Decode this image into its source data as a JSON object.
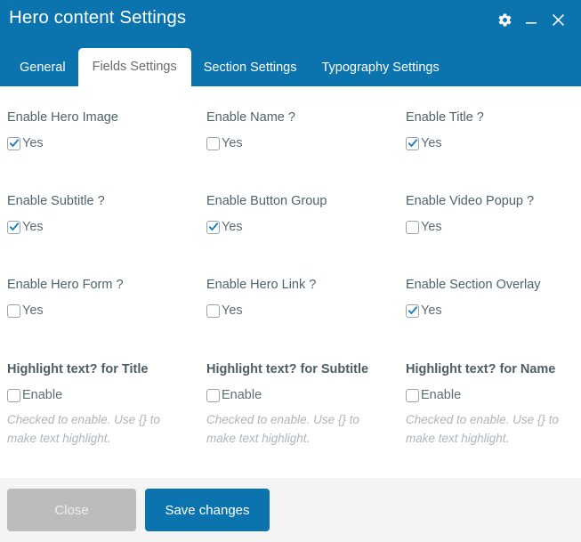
{
  "window": {
    "title": "Hero content Settings",
    "controls": [
      {
        "name": "settings-gear",
        "icon": "gear-icon"
      },
      {
        "name": "minimize",
        "icon": "minimize-icon"
      },
      {
        "name": "close",
        "icon": "close-icon"
      }
    ]
  },
  "tabs": [
    {
      "label": "General",
      "active": false
    },
    {
      "label": "Fields Settings",
      "active": true
    },
    {
      "label": "Section Settings",
      "active": false
    },
    {
      "label": "Typography Settings",
      "active": false
    }
  ],
  "fields": {
    "row1": [
      {
        "label": "Enable Hero Image",
        "checkbox_label": "Yes",
        "checked": true
      },
      {
        "label": "Enable Name ?",
        "checkbox_label": "Yes",
        "checked": false
      },
      {
        "label": "Enable Title ?",
        "checkbox_label": "Yes",
        "checked": true
      }
    ],
    "row2": [
      {
        "label": "Enable Subtitle ?",
        "checkbox_label": "Yes",
        "checked": true
      },
      {
        "label": "Enable Button Group",
        "checkbox_label": "Yes",
        "checked": true
      },
      {
        "label": "Enable Video Popup ?",
        "checkbox_label": "Yes",
        "checked": false
      }
    ],
    "row3": [
      {
        "label": "Enable Hero Form ?",
        "checkbox_label": "Yes",
        "checked": false
      },
      {
        "label": "Enable Hero Link ?",
        "checkbox_label": "Yes",
        "checked": false
      },
      {
        "label": "Enable Section Overlay",
        "checkbox_label": "Yes",
        "checked": true
      }
    ],
    "row4": [
      {
        "label": "Highlight text? for Title",
        "checkbox_label": "Enable",
        "checked": false,
        "help": "Checked to enable. Use {} to make text highlight."
      },
      {
        "label": "Highlight text? for Subtitle",
        "checkbox_label": "Enable",
        "checked": false,
        "help": "Checked to enable. Use {} to make text highlight."
      },
      {
        "label": "Highlight text? for Name",
        "checkbox_label": "Enable",
        "checked": false,
        "help": "Checked to enable. Use {} to make text highlight."
      }
    ]
  },
  "footer": {
    "close_label": "Close",
    "save_label": "Save changes"
  },
  "colors": {
    "header_blue": "#0b74ae",
    "accent_blue": "#1a7fc1",
    "footer_bg": "#f4f4f4",
    "close_btn": "#bcbcbc",
    "label_text": "#50616b",
    "help_text": "#aeb4b8"
  }
}
